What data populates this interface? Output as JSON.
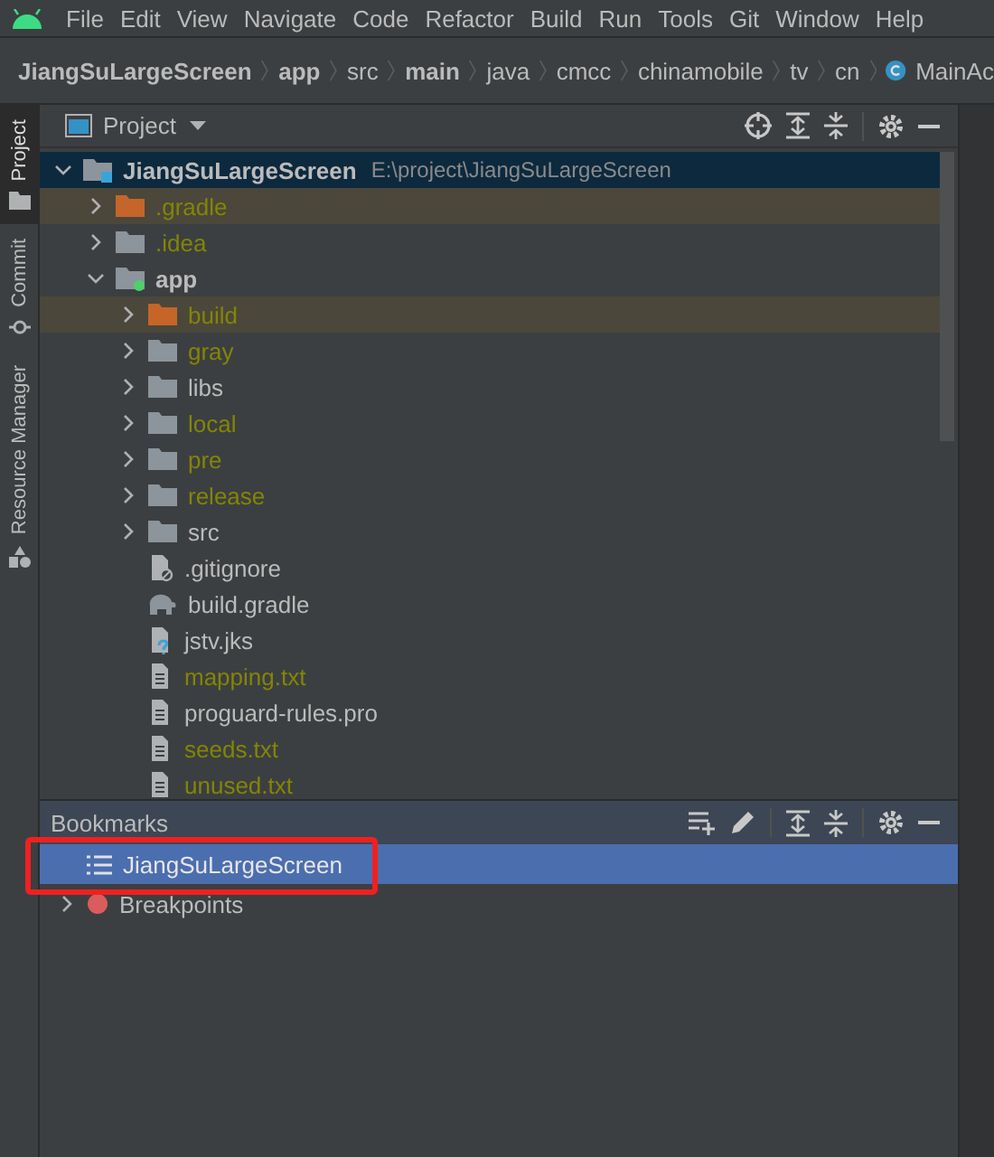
{
  "menu_bar": {
    "items": [
      "File",
      "Edit",
      "View",
      "Navigate",
      "Code",
      "Refactor",
      "Build",
      "Run",
      "Tools",
      "Git",
      "Window",
      "Help"
    ]
  },
  "breadcrumb": [
    {
      "label": "JiangSuLargeScreen",
      "bold": true,
      "kind": "folder"
    },
    {
      "label": "app",
      "bold": true,
      "kind": "folder"
    },
    {
      "label": "src",
      "bold": false,
      "kind": "folder"
    },
    {
      "label": "main",
      "bold": true,
      "kind": "folder"
    },
    {
      "label": "java",
      "bold": false,
      "kind": "folder"
    },
    {
      "label": "cmcc",
      "bold": false,
      "kind": "folder"
    },
    {
      "label": "chinamobile",
      "bold": false,
      "kind": "folder"
    },
    {
      "label": "tv",
      "bold": false,
      "kind": "folder"
    },
    {
      "label": "cn",
      "bold": false,
      "kind": "folder"
    },
    {
      "label": "MainAc",
      "bold": false,
      "kind": "class"
    }
  ],
  "tool_strip": [
    {
      "label": "Project",
      "selected": true,
      "kind": "project"
    },
    {
      "label": "Commit",
      "selected": false,
      "kind": "commit"
    },
    {
      "label": "Resource Manager",
      "selected": false,
      "kind": "resources"
    }
  ],
  "project_panel": {
    "title": "Project",
    "tree": [
      {
        "name": "JiangSuLargeScreen",
        "path": "E:\\project\\JiangSuLargeScreen",
        "kind": "project",
        "expanded": true,
        "selected": true,
        "highlighted": false,
        "color": "#bbbbbb",
        "children": [
          {
            "name": ".gradle",
            "kind": "folder-excluded",
            "expanded": false,
            "selected": false,
            "highlighted": true,
            "color": "#848504"
          },
          {
            "name": ".idea",
            "kind": "folder",
            "expanded": false,
            "selected": false,
            "highlighted": false,
            "color": "#848504"
          },
          {
            "name": "app",
            "kind": "module",
            "expanded": true,
            "selected": false,
            "highlighted": false,
            "color": "#bbbbbb",
            "children": [
              {
                "name": "build",
                "kind": "folder-excluded",
                "expanded": false,
                "selected": false,
                "highlighted": true,
                "color": "#848504"
              },
              {
                "name": "gray",
                "kind": "folder",
                "expanded": false,
                "selected": false,
                "highlighted": false,
                "color": "#848504"
              },
              {
                "name": "libs",
                "kind": "folder",
                "expanded": false,
                "selected": false,
                "highlighted": false,
                "color": "#bbbbbb"
              },
              {
                "name": "local",
                "kind": "folder",
                "expanded": false,
                "selected": false,
                "highlighted": false,
                "color": "#848504"
              },
              {
                "name": "pre",
                "kind": "folder",
                "expanded": false,
                "selected": false,
                "highlighted": false,
                "color": "#848504"
              },
              {
                "name": "release",
                "kind": "folder",
                "expanded": false,
                "selected": false,
                "highlighted": false,
                "color": "#848504"
              },
              {
                "name": "src",
                "kind": "folder",
                "expanded": false,
                "selected": false,
                "highlighted": false,
                "color": "#bbbbbb"
              },
              {
                "name": ".gitignore",
                "kind": "ignore-file",
                "selected": false,
                "highlighted": false,
                "color": "#bbbbbb"
              },
              {
                "name": "build.gradle",
                "kind": "gradle-file",
                "selected": false,
                "highlighted": false,
                "color": "#bbbbbb"
              },
              {
                "name": "jstv.jks",
                "kind": "unknown-file",
                "selected": false,
                "highlighted": false,
                "color": "#bbbbbb"
              },
              {
                "name": "mapping.txt",
                "kind": "text-file",
                "selected": false,
                "highlighted": false,
                "color": "#848504"
              },
              {
                "name": "proguard-rules.pro",
                "kind": "text-file",
                "selected": false,
                "highlighted": false,
                "color": "#bbbbbb"
              },
              {
                "name": "seeds.txt",
                "kind": "text-file",
                "selected": false,
                "highlighted": false,
                "color": "#848504"
              },
              {
                "name": "unused.txt",
                "kind": "text-file",
                "selected": false,
                "highlighted": false,
                "color": "#848504"
              }
            ]
          }
        ]
      }
    ]
  },
  "bookmarks_panel": {
    "title": "Bookmarks",
    "items": [
      {
        "label": "JiangSuLargeScreen",
        "kind": "list",
        "selected": true,
        "annotated": true
      },
      {
        "label": "Breakpoints",
        "kind": "breakpoints",
        "selected": false,
        "annotated": false
      }
    ]
  }
}
